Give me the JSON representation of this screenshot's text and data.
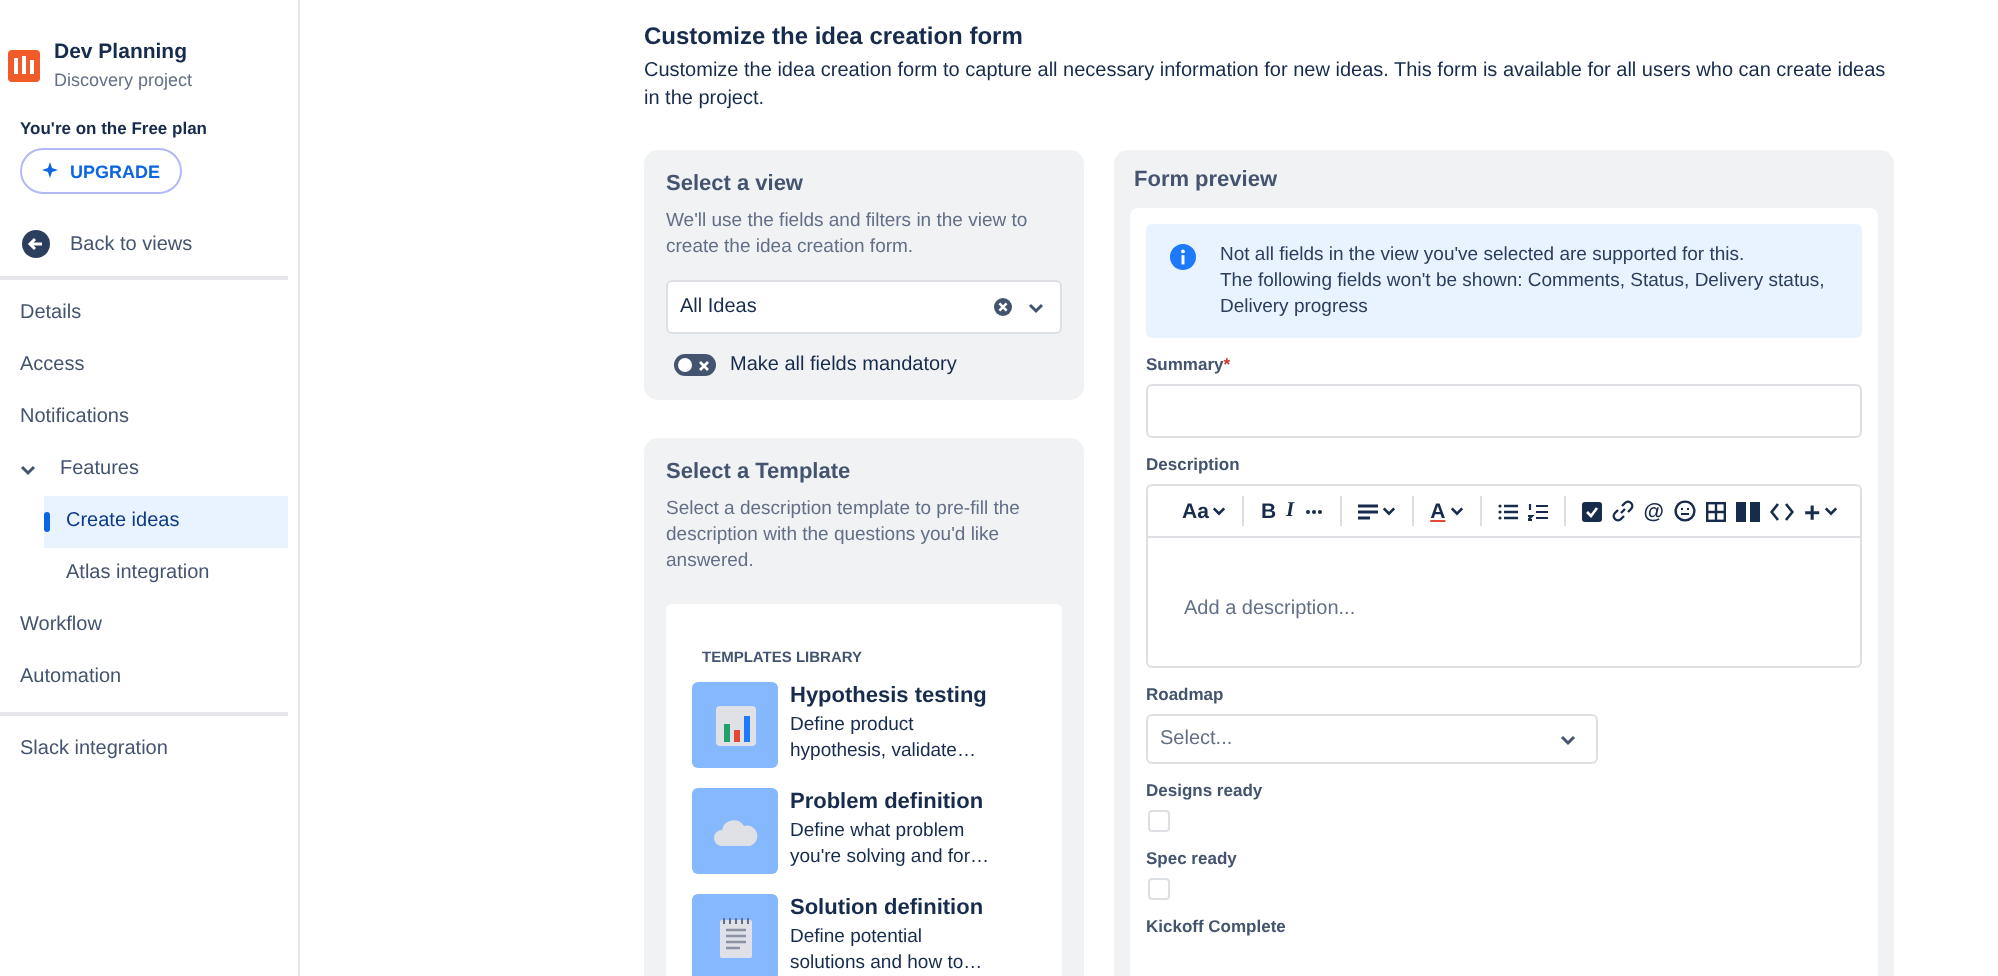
{
  "sidebar": {
    "project": {
      "name": "Dev Planning",
      "subtitle": "Discovery project"
    },
    "plan_note": "You're on the Free plan",
    "upgrade_button": "UPGRADE",
    "back_link": "Back to views",
    "sections": [
      [
        {
          "label": "Details",
          "selected": false
        },
        {
          "label": "Access",
          "selected": false
        },
        {
          "label": "Notifications",
          "selected": false
        },
        {
          "label": "Features",
          "selected": false,
          "expanded": true,
          "children": [
            {
              "label": "Create ideas",
              "selected": true
            },
            {
              "label": "Atlas integration",
              "selected": false
            }
          ]
        },
        {
          "label": "Workflow",
          "selected": false
        },
        {
          "label": "Automation",
          "selected": false
        }
      ],
      [
        {
          "label": "Slack integration",
          "selected": false
        }
      ]
    ]
  },
  "header": {
    "title": "Customize the idea creation form",
    "description": "Customize the idea creation form to capture all necessary information for new ideas. This form is available for all users who can create ideas in the project."
  },
  "view_card": {
    "title": "Select a view",
    "description": "We'll use the fields and filters in the view to create the idea creation form.",
    "select_value": "All Ideas",
    "mandatory_toggle": {
      "label": "Make all fields mandatory",
      "on": false
    }
  },
  "template_card": {
    "title": "Select a Template",
    "description": "Select a description template to pre-fill the description with the questions you'd like answered.",
    "library_heading": "TEMPLATES LIBRARY",
    "templates": [
      {
        "kind": "chart",
        "title": "Hypothesis testing",
        "description": "Define product hypothesis, validate…"
      },
      {
        "kind": "cloud",
        "title": "Problem definition",
        "description": "Define what problem you're solving and for…"
      },
      {
        "kind": "notepad",
        "title": "Solution definition",
        "description": "Define potential solutions and how to…"
      }
    ]
  },
  "form_preview": {
    "title": "Form preview",
    "notice": {
      "line_1": "Not all fields in the view you've selected are supported for this.",
      "line_2": "The following fields won't be shown: Comments, Status, Delivery status, Delivery progress"
    },
    "toolbar": [
      [
        {
          "kind": "text-style",
          "label": "Aa",
          "dropdown": true
        }
      ],
      [
        {
          "kind": "bold",
          "label": "B"
        },
        {
          "kind": "italic",
          "label": "I"
        },
        {
          "kind": "more"
        }
      ],
      [
        {
          "kind": "align",
          "dropdown": true
        }
      ],
      [
        {
          "kind": "text-color",
          "label": "A",
          "dropdown": true
        }
      ],
      [
        {
          "kind": "bullet-list"
        },
        {
          "kind": "numbered-list"
        }
      ],
      [
        {
          "kind": "task"
        },
        {
          "kind": "link"
        },
        {
          "kind": "mention",
          "label": "@"
        },
        {
          "kind": "emoji"
        },
        {
          "kind": "table"
        },
        {
          "kind": "layout"
        },
        {
          "kind": "code"
        },
        {
          "kind": "insert",
          "label": "+",
          "dropdown": true
        }
      ]
    ],
    "fields": [
      {
        "kind": "text",
        "label": "Summary",
        "required_mark": "*"
      },
      {
        "kind": "editor",
        "label": "Description",
        "placeholder": "Add a description..."
      },
      {
        "kind": "select",
        "label": "Roadmap",
        "placeholder": "Select..."
      },
      {
        "kind": "checkbox",
        "label": "Designs ready",
        "checked": false
      },
      {
        "kind": "checkbox",
        "label": "Spec ready",
        "checked": false
      },
      {
        "kind": "checkbox",
        "label": "Kickoff Complete"
      }
    ]
  }
}
